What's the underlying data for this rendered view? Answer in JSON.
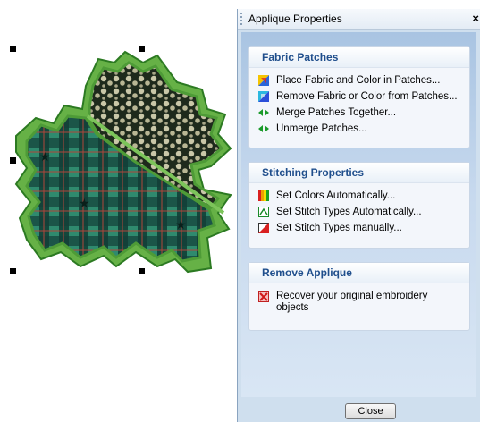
{
  "panel": {
    "title": "Applique Properties",
    "close_glyph": "×",
    "sections": [
      {
        "title": "Fabric Patches",
        "items": [
          {
            "label": "Place Fabric and Color in Patches...",
            "icon": "fabric-color-icon"
          },
          {
            "label": "Remove Fabric or Color from Patches...",
            "icon": "remove-fabric-icon"
          },
          {
            "label": "Merge Patches Together...",
            "icon": "merge-icon"
          },
          {
            "label": "Unmerge Patches...",
            "icon": "unmerge-icon"
          }
        ]
      },
      {
        "title": "Stitching Properties",
        "items": [
          {
            "label": "Set Colors Automatically...",
            "icon": "color-bars-icon"
          },
          {
            "label": "Set Stitch Types Automatically...",
            "icon": "stitch-auto-icon"
          },
          {
            "label": "Set Stitch Types manually...",
            "icon": "stitch-manual-icon"
          }
        ]
      },
      {
        "title": "Remove Applique",
        "items": [
          {
            "label": "Recover your original embroidery",
            "label2": "objects",
            "icon": "recover-icon"
          }
        ]
      }
    ],
    "close_button": "Close"
  },
  "colors": {
    "accent": "#1f4e8c",
    "panel_bg": "#cfdfee"
  }
}
